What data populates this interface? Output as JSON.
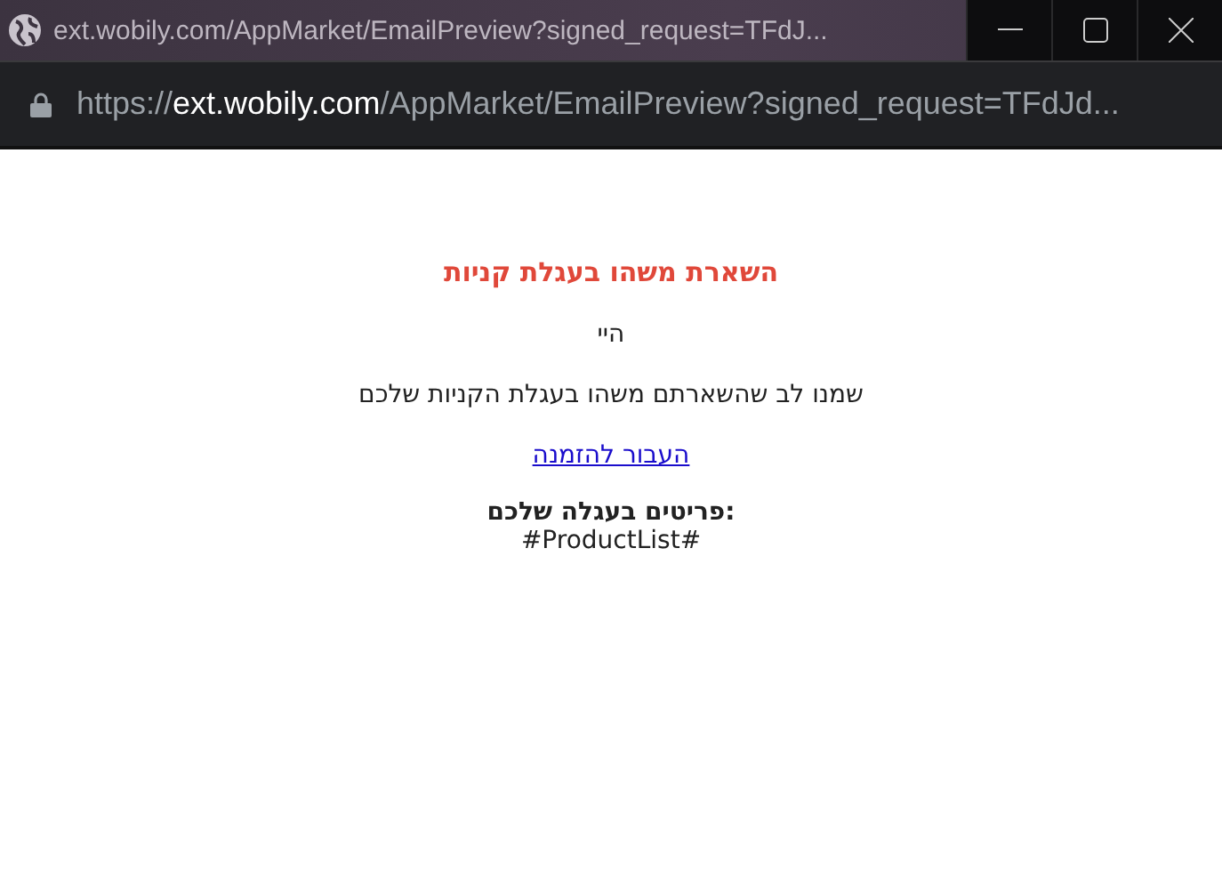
{
  "window": {
    "title": "ext.wobily.com/AppMarket/EmailPreview?signed_request=TFdJ..."
  },
  "address_bar": {
    "scheme": "https://",
    "host": "ext.wobily.com",
    "rest": "/AppMarket/EmailPreview?signed_request=TFdJd..."
  },
  "email": {
    "heading": "השארת משהו בעגלת קניות",
    "greeting": "היי",
    "message": "שמנו לב שהשארתם משהו בעגלת הקניות שלכם",
    "link": "העבור להזמנה",
    "items_heading": "פריטים בעגלה שלכם:",
    "items_placeholder": "#ProductList#"
  }
}
